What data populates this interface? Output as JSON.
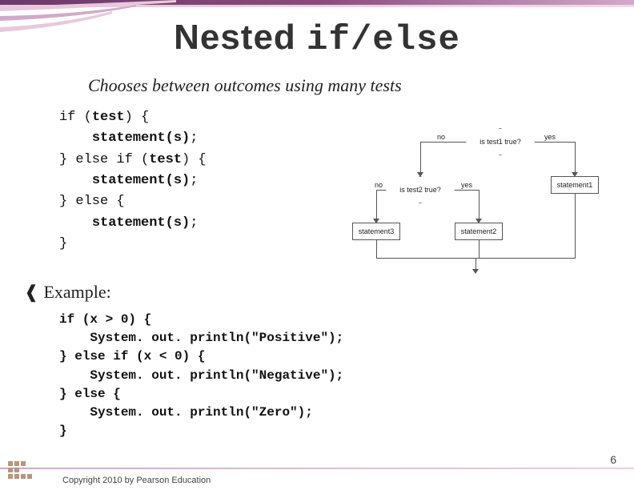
{
  "title": {
    "text1": "Nested ",
    "text2": "if/else"
  },
  "subtitle": "Chooses between outcomes using many tests",
  "code_template": {
    "l1_a": "if (",
    "l1_b": "test",
    "l1_c": ") {",
    "l2_a": "    ",
    "l2_b": "statement(s)",
    "l2_c": ";",
    "l3_a": "} else if (",
    "l3_b": "test",
    "l3_c": ") {",
    "l4_a": "    ",
    "l4_b": "statement(s)",
    "l4_c": ";",
    "l5": "} else {",
    "l6_a": "    ",
    "l6_b": "statement(s)",
    "l6_c": ";",
    "l7": "}"
  },
  "example_label": "Example:",
  "example_code": "if (x > 0) {\n    System. out. println(\"Positive\");\n} else if (x < 0) {\n    System. out. println(\"Negative\");\n} else {\n    System. out. println(\"Zero\");\n}",
  "flowchart": {
    "d1": "is test1 true?",
    "d2": "is test2 true?",
    "s1": "statement1",
    "s2": "statement2",
    "s3": "statement3",
    "yes": "yes",
    "no": "no"
  },
  "copyright": "Copyright 2010 by Pearson Education",
  "page_number": "6"
}
